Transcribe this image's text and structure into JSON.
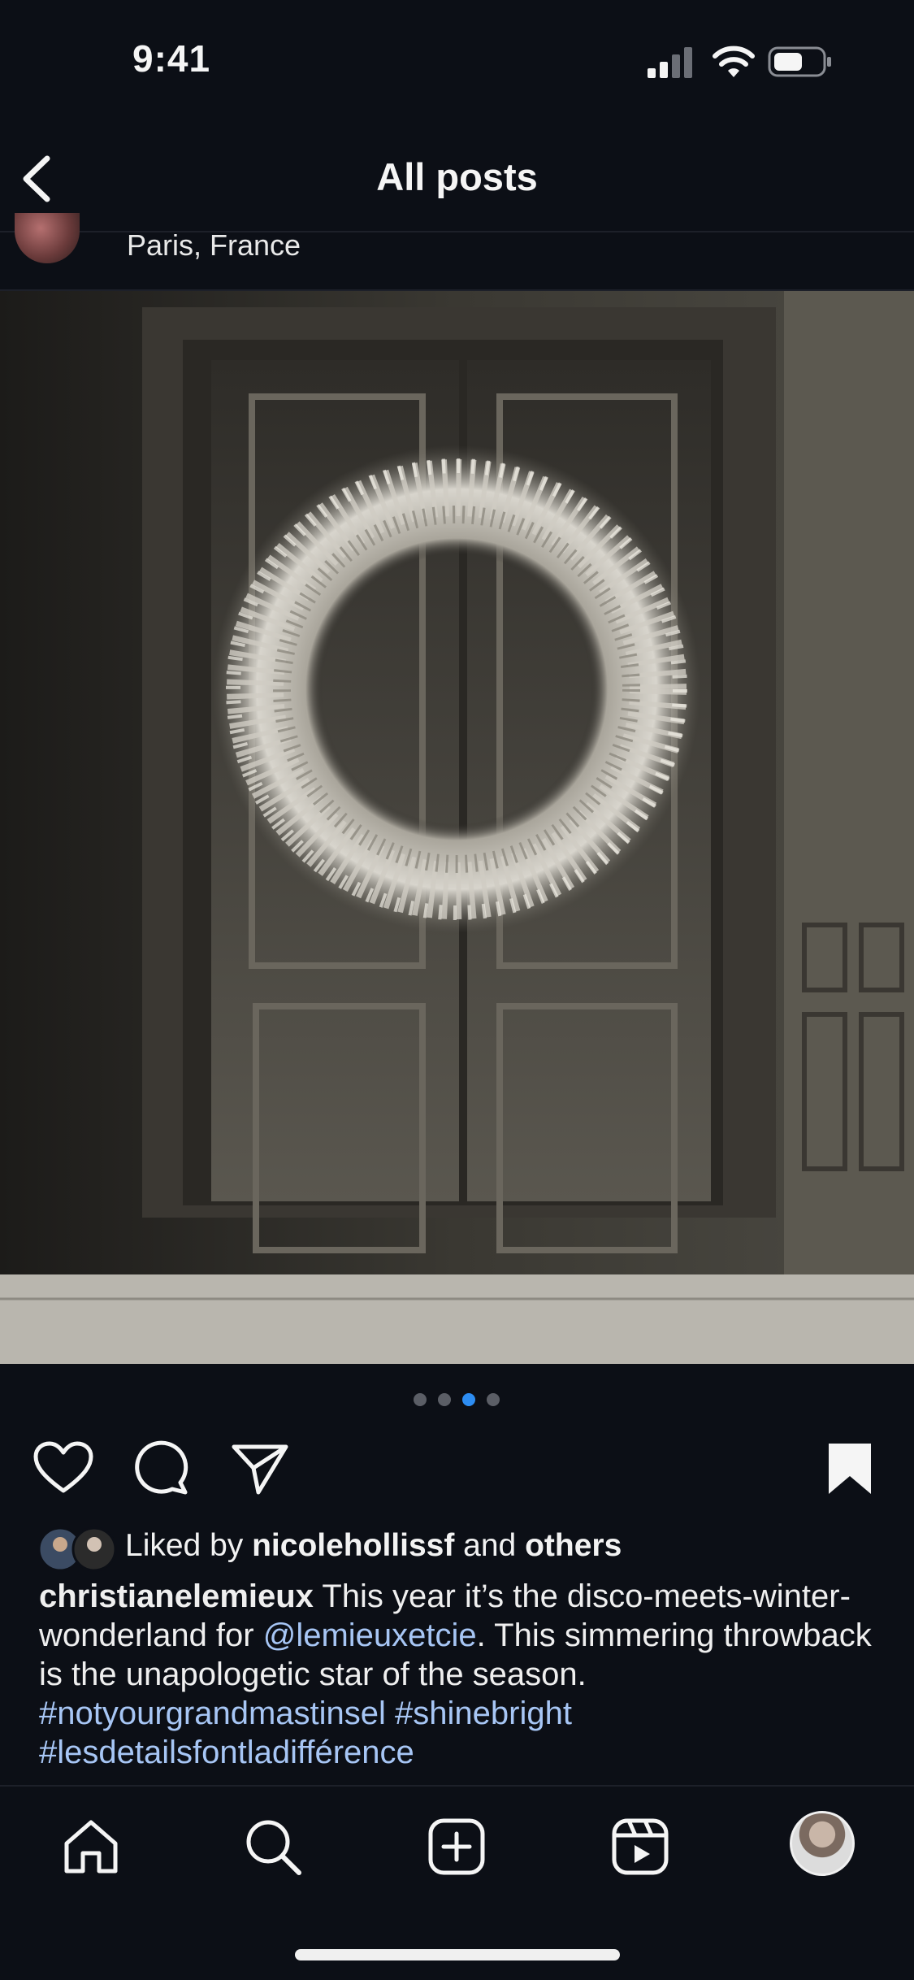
{
  "status_bar": {
    "time": "9:41",
    "icons": [
      "cellular-signal-icon",
      "wifi-icon",
      "battery-icon"
    ]
  },
  "nav": {
    "back_icon": "chevron-left-icon",
    "title": "All posts"
  },
  "post": {
    "location": "Paris, France",
    "image_description_icon": "photo",
    "carousel": {
      "count": 4,
      "active_index": 2
    },
    "actions": {
      "like_icon": "heart-icon",
      "comment_icon": "comment-icon",
      "share_icon": "send-icon",
      "save_icon": "bookmark-icon",
      "saved": true
    },
    "likes": {
      "prefix": "Liked by",
      "user": "nicolehollissf",
      "conjunction": "and",
      "others": "others"
    },
    "caption": {
      "username": "christianelemieux",
      "text_1": "This year it’s the disco-meets-winter-wonderland for",
      "mention": "@lemieuxetcie",
      "text_2": ". This simmering throwback is the unapologetic star of the season.",
      "hashtag_1": "#notyourgrandmastinsel",
      "hashtag_2": "#shinebright",
      "hashtag_3": "#lesdetailsfontladifférence"
    }
  },
  "tab_bar": {
    "items": [
      "home-icon",
      "search-icon",
      "create-icon",
      "reels-icon",
      "profile-avatar"
    ]
  },
  "colors": {
    "background": "#0c0f16",
    "link": "#a7c6f5",
    "active_dot": "#2d8df2"
  }
}
